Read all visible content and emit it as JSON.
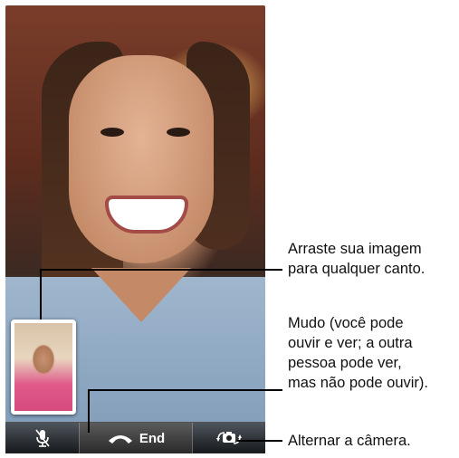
{
  "toolbar": {
    "end_label": "End"
  },
  "callouts": {
    "drag_line1": "Arraste sua imagem",
    "drag_line2": "para qualquer canto.",
    "mute_line1": "Mudo (você pode",
    "mute_line2": "ouvir e ver; a outra",
    "mute_line3": "pessoa pode ver,",
    "mute_line4": "mas não pode ouvir).",
    "switch_line1": "Alternar a câmera."
  },
  "colors": {
    "end_button": "#3a3a3a",
    "callout_text": "#111111"
  }
}
